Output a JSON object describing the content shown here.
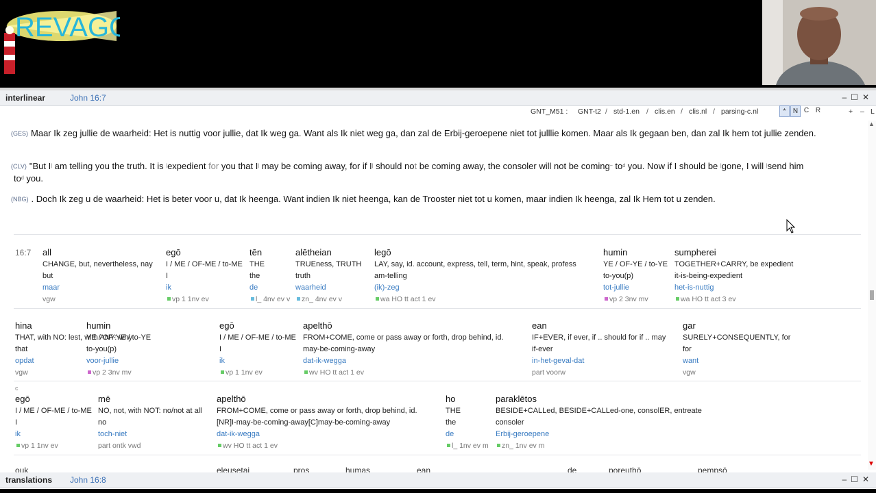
{
  "logo": {
    "text": "REVAGO"
  },
  "interlinear_panel": {
    "title": "interlinear",
    "reference": "John 16:7",
    "window_buttons": [
      "–",
      "☐",
      "✕"
    ]
  },
  "tabs": {
    "items": [
      "GNT_M51 :",
      "GNT-t2",
      "std-1.en",
      "clis.en",
      "clis.nl",
      "parsing-c.nl"
    ],
    "modes": [
      "*",
      "N",
      "C",
      "R"
    ],
    "zoom": [
      "+",
      "–",
      "L"
    ]
  },
  "verses": {
    "ges_tag": "(GES)",
    "ges_text": "Maar Ik zeg jullie de waarheid: Het is nuttig voor jullie, dat Ik weg ga. Want als Ik niet weg ga, dan zal de Erbij-geroepene niet tot julllie komen. Maar als Ik gegaan ben, dan zal Ik hem tot jullie zenden.",
    "clv_tag": "(CLV)",
    "clv_p1": "\"But I",
    "clv_p2": " am telling you the truth. It is ",
    "clv_p3": "expedient ",
    "clv_p4": "for",
    "clv_p5": " you that I",
    "clv_p6": " may be coming away, for if I",
    "clv_p7": " should no",
    "clv_p8": "t",
    "clv_p9": " be coming away, the consoler will not be coming",
    "clv_p10": " to",
    "clv_p11": " you. Now if I should be ",
    "clv_p12": "gone, I will ",
    "clv_p13": "send him",
    "clv_l2a": "to",
    "clv_l2b": " you.",
    "sup_bar": "|",
    "sup_d": "d",
    "sup_tilde": "~",
    "nbg_tag": "(NBG)",
    "nbg_text": ". Doch Ik zeg u de waarheid: Het is beter voor u, dat Ik heenga. Want indien Ik niet heenga, kan de Trooster niet tot u komen, maar indien Ik heenga, zal Ik Hem tot u zenden."
  },
  "verse_ref": "16:7",
  "rows": [
    [
      {
        "g": "all",
        "e1": "CHANGE, but, nevertheless, nay",
        "e2": "but",
        "d": "maar",
        "m": "vgw",
        "c": ""
      },
      {
        "g": "egō",
        "e1": "I / ME / OF-ME / to-ME",
        "e2": "I",
        "d": "ik",
        "m": "vp 1 1nv ev",
        "c": "#6c6"
      },
      {
        "g": "tēn",
        "e1": "THE",
        "e2": "the",
        "d": "de",
        "m": "l_ 4nv ev v",
        "c": "#6bd"
      },
      {
        "g": "alētheian",
        "e1": "TRUEness, TRUTH",
        "e2": "truth",
        "d": "waarheid",
        "m": "zn_ 4nv ev v",
        "c": "#6bd"
      },
      {
        "g": "legō",
        "e1": "LAY, say, id. account, express, tell, term, hint, speak, profess",
        "e2": "am-telling",
        "d": "(ik)-zeg",
        "m": "wa HO tt act 1 ev",
        "c": "#6c6"
      },
      {
        "g": "humin",
        "e1": "YE / OF-YE / to-YE",
        "e2": "to-you(p)",
        "d": "tot-jullie",
        "m": "vp 2 3nv mv",
        "c": "#c6c"
      },
      {
        "g": "sumpherei",
        "e1": "TOGETHER+CARRY, be expedient",
        "e2": "it-is-being-expedient",
        "d": "het-is-nuttig",
        "m": "wa HO tt act 3 ev",
        "c": "#6c6"
      }
    ],
    [
      {
        "g": "hina",
        "e1": "THAT, with NO: lest, with ANY: why",
        "e2": "that",
        "d": "opdat",
        "m": "vgw",
        "c": ""
      },
      {
        "g": "humin",
        "e1": "YE / OF-YE / to-YE",
        "e2": "to-you(p)",
        "d": "voor-jullie",
        "m": "vp 2 3nv mv",
        "c": "#c6c"
      },
      {
        "g": "egō",
        "e1": "I / ME / OF-ME / to-ME",
        "e2": "I",
        "d": "ik",
        "m": "vp 1 1nv ev",
        "c": "#6c6"
      },
      {
        "g": "apelthō",
        "e1": "FROM+COME, come or pass away or forth, drop behind, id.",
        "e2": "may-be-coming-away",
        "d": "dat-ik-wegga",
        "m": "wv HO tt act 1 ev",
        "c": "#6c6"
      },
      {
        "g": "ean",
        "e1": "IF+EVER, if ever, if .. should for if .. may",
        "e2": "if-ever",
        "d": "in-het-geval-dat",
        "m": "part voorw",
        "c": ""
      },
      {
        "g": "gar",
        "e1": "SURELY+CONSEQUENTLY, for",
        "e2": "for",
        "d": "want",
        "m": "vgw",
        "c": ""
      }
    ],
    [
      {
        "g": "egō",
        "e1": "I / ME / OF-ME / to-ME",
        "e2": "I",
        "d": "ik",
        "m": "vp 1 1nv ev",
        "c": "#6c6"
      },
      {
        "g": "mē",
        "e1": "NO, not, with NOT: no/not at all",
        "e2": "no",
        "d": "toch-niet",
        "m": "part ontk vwd",
        "c": ""
      },
      {
        "g": "apelthō",
        "e1": "FROM+COME, come or pass away or forth, drop behind, id.",
        "e2": "[NR]I-may-be-coming-away[C]may-be-coming-away",
        "d": "dat-ik-wegga",
        "m": "wv HO tt act 1 ev",
        "c": "#6c6"
      },
      {
        "g": "ho",
        "e1": "THE",
        "e2": "the",
        "d": "de",
        "m": "l_ 1nv ev m",
        "c": "#6c6"
      },
      {
        "g": "paraklētos",
        "e1": "BESIDE+CALLed, BESIDE+CALLed-one, consolER, entreate",
        "e2": "consoler",
        "d": "Erbij-geroepene",
        "m": "zn_ 1nv ev m",
        "c": "#6c6"
      }
    ]
  ],
  "c_mark": "c",
  "cut_row": [
    "ouk",
    "eleusetai",
    "pros",
    "humas",
    "ean",
    "de",
    "poreuthō",
    "pempsō"
  ],
  "translations_panel": {
    "title": "translations",
    "reference": "John 16:8"
  }
}
